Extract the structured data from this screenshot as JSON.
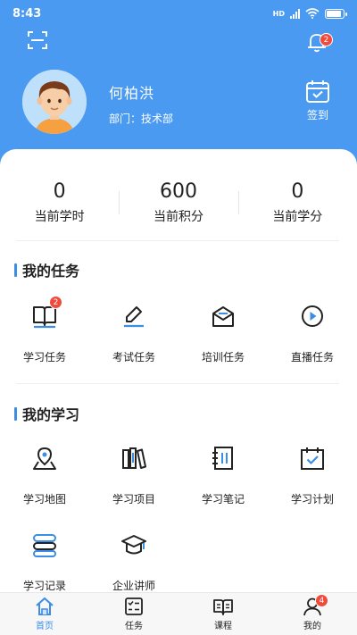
{
  "status_bar": {
    "time": "8:43",
    "network": "HD",
    "battery_level": 0.9
  },
  "header": {
    "scan_icon": "scan-icon",
    "bell_icon": "bell-icon",
    "notification_count": "2",
    "user_name": "何柏洪",
    "department": "部门：技术部",
    "signin_label": "签到",
    "colors": {
      "header_bg": "#4a9af1",
      "accent": "#3a8ee6",
      "badge": "#f04a3c"
    }
  },
  "stats": [
    {
      "value": "0",
      "label": "当前学时"
    },
    {
      "value": "600",
      "label": "当前积分"
    },
    {
      "value": "0",
      "label": "当前学分"
    }
  ],
  "my_tasks": {
    "title": "我的任务",
    "items": [
      {
        "label": "学习任务",
        "icon": "book-icon",
        "badge": "2"
      },
      {
        "label": "考试任务",
        "icon": "pen-icon"
      },
      {
        "label": "培训任务",
        "icon": "envelope-icon"
      },
      {
        "label": "直播任务",
        "icon": "play-icon"
      }
    ]
  },
  "my_learning": {
    "title": "我的学习",
    "items": [
      {
        "label": "学习地图",
        "icon": "map-pin-icon"
      },
      {
        "label": "学习项目",
        "icon": "books-icon"
      },
      {
        "label": "学习笔记",
        "icon": "notebook-icon"
      },
      {
        "label": "学习计划",
        "icon": "calendar-check-icon"
      },
      {
        "label": "学习记录",
        "icon": "stack-icon"
      },
      {
        "label": "企业讲师",
        "icon": "graduation-cap-icon"
      }
    ]
  },
  "tabbar": [
    {
      "label": "首页",
      "icon": "home-icon",
      "active": true
    },
    {
      "label": "任务",
      "icon": "task-list-icon"
    },
    {
      "label": "课程",
      "icon": "open-book-icon"
    },
    {
      "label": "我的",
      "icon": "person-icon",
      "badge": "4"
    }
  ]
}
